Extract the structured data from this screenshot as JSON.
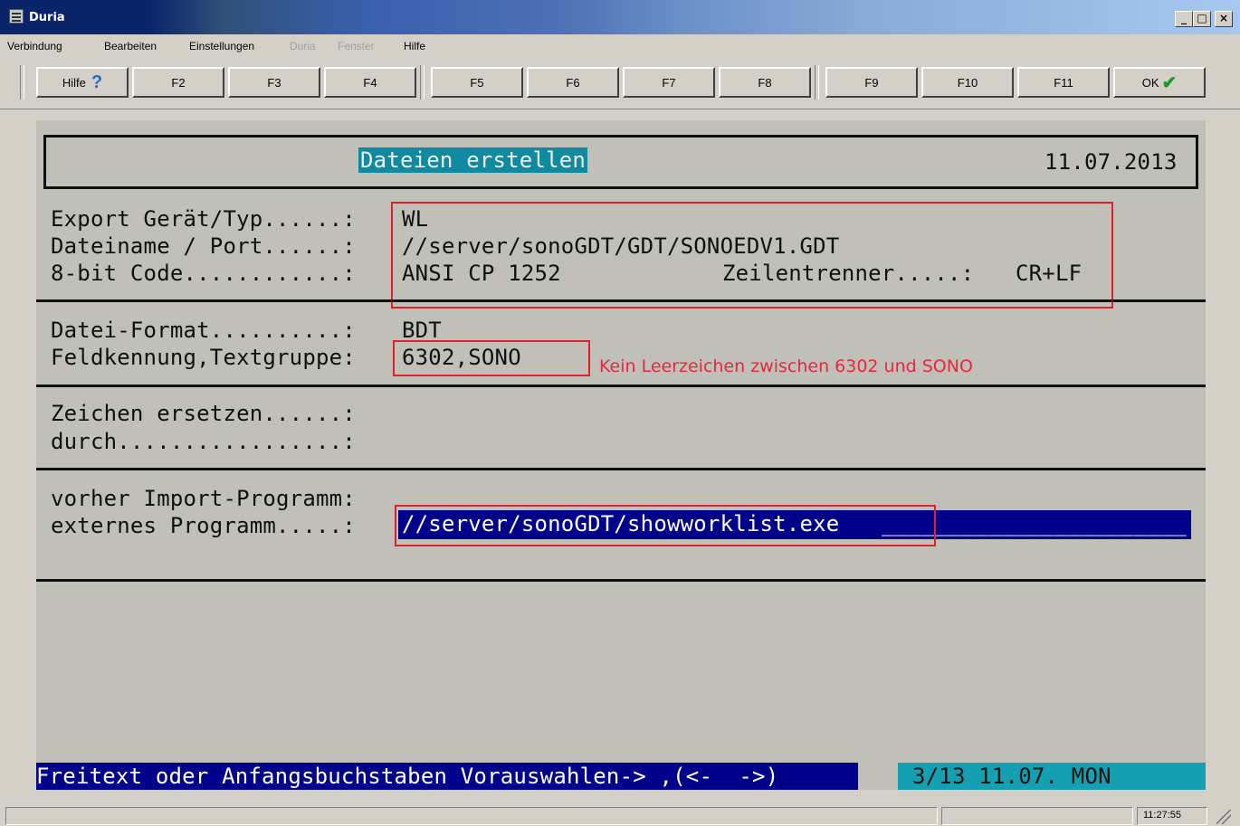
{
  "window": {
    "title": "Duria",
    "controls": {
      "minimize": "_",
      "maximize": "□",
      "close": "×"
    }
  },
  "menu": [
    {
      "label": "Verbindung",
      "enabled": true
    },
    {
      "label": "Bearbeiten",
      "enabled": true
    },
    {
      "label": "Einstellungen",
      "enabled": true
    },
    {
      "label": "Duria",
      "enabled": false
    },
    {
      "label": "Fenster",
      "enabled": false
    },
    {
      "label": "Hilfe",
      "enabled": true
    }
  ],
  "toolbar": {
    "help": "Hilfe",
    "help_icon": "?",
    "keys": [
      "F2",
      "F3",
      "F4",
      "F5",
      "F6",
      "F7",
      "F8",
      "F9",
      "F10",
      "F11"
    ],
    "ok": "OK",
    "ok_icon": "✔"
  },
  "screen": {
    "title": "Dateien erstellen",
    "date": "11.07.2013",
    "export_label": "Export Gerät/Typ......:",
    "export_value": "WL",
    "filename_label": "Dateiname / Port......:",
    "filename_value": "//server/sonoGDT/GDT/SONOEDV1.GDT",
    "code_label": "8-bit Code............:",
    "code_value": "ANSI CP 1252",
    "separator_label": "Zeilentrenner.....:",
    "separator_value": "CR+LF",
    "format_label": "Datei-Format..........:",
    "format_value": "BDT",
    "field_label": "Feldkennung,Textgruppe:",
    "field_value": "6302,SONO",
    "note": "Kein Leerzeichen zwischen 6302 und SONO",
    "replace_label": "Zeichen ersetzen......:",
    "with_label": "durch.................:",
    "import_label": "vorher Import-Programm:",
    "external_label": "externes Programm.....:",
    "external_value": "//server/sonoGDT/showworklist.exe",
    "external_fill": "_______________________",
    "hint": "Freitext oder Anfangsbuchstaben Vorauswahlen-> ,(<-  ->)",
    "status_right": "3/13 11.07. MON"
  },
  "statusbar": {
    "time": "11:27:55"
  },
  "colors": {
    "input_bg": "#00008b",
    "title_bg": "#0f8aa0",
    "status_right_bg": "#14a0b0",
    "annotation": "#e0202a"
  }
}
